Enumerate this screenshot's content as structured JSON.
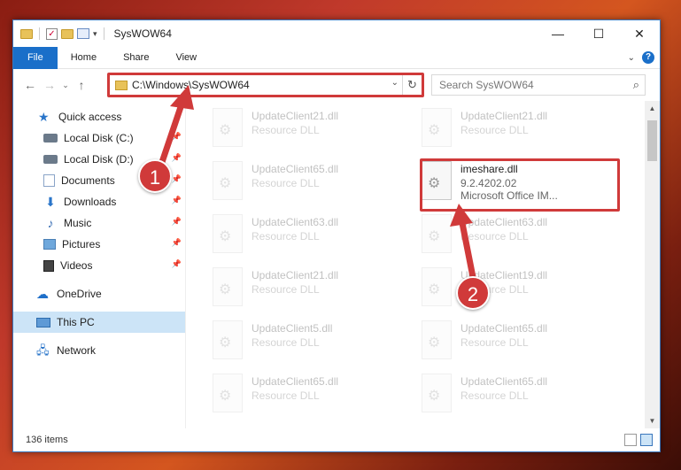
{
  "window": {
    "title": "SysWOW64"
  },
  "window_controls": {
    "minimize": "—",
    "maximize": "☐",
    "close": "✕"
  },
  "ribbon": {
    "tabs": [
      "File",
      "Home",
      "Share",
      "View"
    ]
  },
  "address": {
    "path": "C:\\Windows\\SysWOW64"
  },
  "search": {
    "placeholder": "Search SysWOW64"
  },
  "sidebar": {
    "items": [
      {
        "label": "Quick access"
      },
      {
        "label": "Local Disk (C:)"
      },
      {
        "label": "Local Disk (D:)"
      },
      {
        "label": "Documents"
      },
      {
        "label": "Downloads"
      },
      {
        "label": "Music"
      },
      {
        "label": "Pictures"
      },
      {
        "label": "Videos"
      },
      {
        "label": "OneDrive"
      },
      {
        "label": "This PC"
      },
      {
        "label": "Network"
      }
    ]
  },
  "files": [
    {
      "name": "UpdateClient21.dll",
      "sub": "Resource DLL"
    },
    {
      "name": "UpdateClient21.dll",
      "sub": "Resource DLL"
    },
    {
      "name": "UpdateClient65.dll",
      "sub": "Resource DLL"
    },
    {
      "name": "imeshare.dll",
      "version": "9.2.4202.02",
      "desc": "Microsoft Office IM..."
    },
    {
      "name": "UpdateClient63.dll",
      "sub": "Resource DLL"
    },
    {
      "name": "UpdateClient63.dll",
      "sub": "Resource DLL"
    },
    {
      "name": "UpdateClient21.dll",
      "sub": "Resource DLL"
    },
    {
      "name": "UpdateClient19.dll",
      "sub": "Resource DLL"
    },
    {
      "name": "UpdateClient5.dll",
      "sub": "Resource DLL"
    },
    {
      "name": "UpdateClient65.dll",
      "sub": "Resource DLL"
    },
    {
      "name": "UpdateClient65.dll",
      "sub": "Resource DLL"
    },
    {
      "name": "UpdateClient65.dll",
      "sub": "Resource DLL"
    }
  ],
  "status": {
    "item_count": "136 items"
  },
  "annotations": {
    "step1": "1",
    "step2": "2"
  },
  "colors": {
    "highlight": "#d03a3a",
    "accent": "#1a6fc9"
  }
}
